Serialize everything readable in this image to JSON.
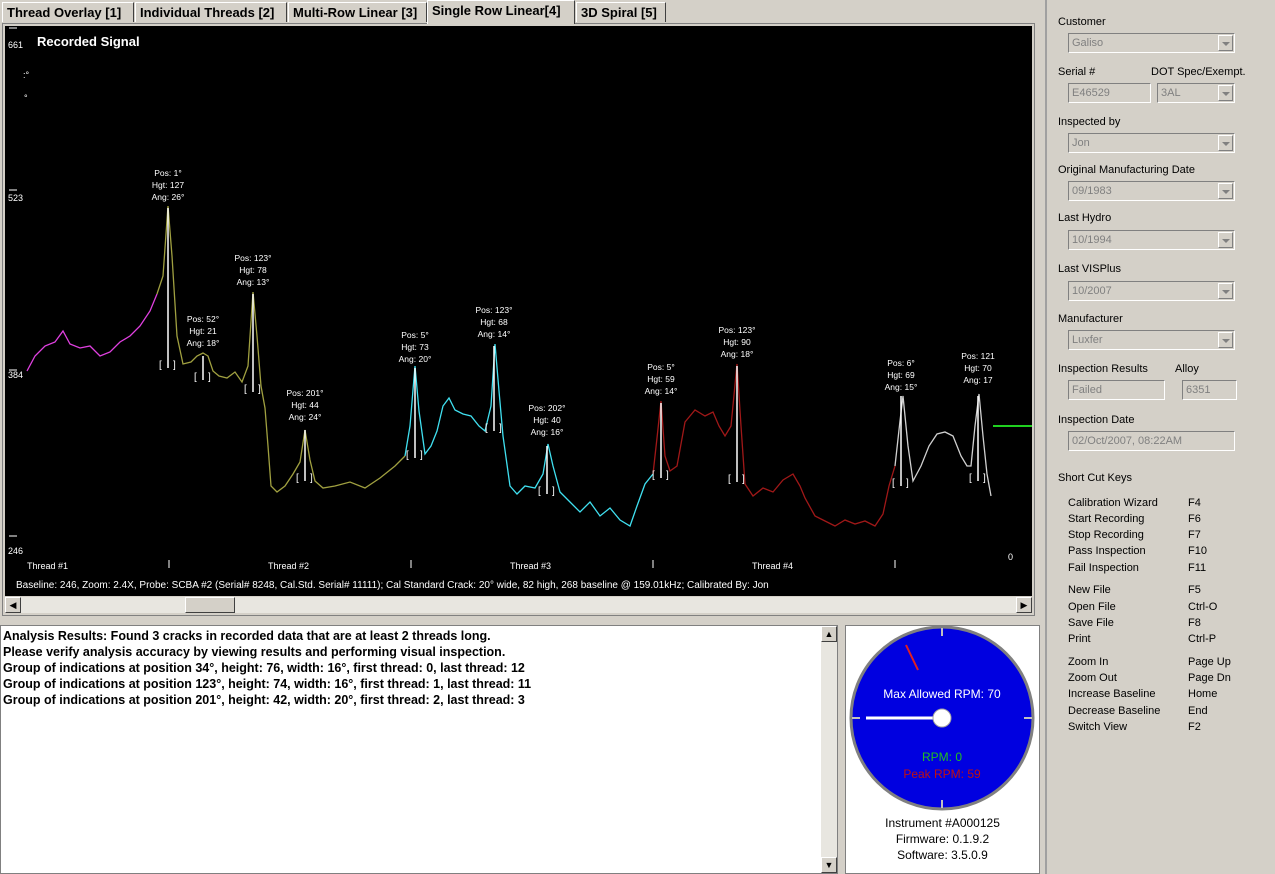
{
  "tabs": [
    {
      "label": "Thread Overlay [1]",
      "active": false
    },
    {
      "label": "Individual Threads [2]",
      "active": false
    },
    {
      "label": "Multi-Row Linear [3]",
      "active": false
    },
    {
      "label": "Single Row Linear[4]",
      "active": true
    },
    {
      "label": "3D Spiral [5]",
      "active": false
    }
  ],
  "plot": {
    "title": "Recorded Signal",
    "y_ticks": [
      "661",
      "523",
      "384",
      "246"
    ],
    "corner_label": "0",
    "thread_labels": [
      "Thread #1",
      "Thread #2",
      "Thread #3",
      "Thread #4"
    ],
    "footer": "Baseline: 246, Zoom: 2.4X, Probe: SCBA #2 (Serial# 8248, Cal.Std. Serial# 11111); Cal Standard Crack: 20° wide, 82 high, 268 baseline @ 159.01kHz; Calibrated By: Jon",
    "peak_labels": [
      {
        "pos": "Pos: 1°",
        "hgt": "Hgt: 127",
        "ang": "Ang: 26°"
      },
      {
        "pos": "Pos: 52°",
        "hgt": "Hgt: 21",
        "ang": "Ang: 18°"
      },
      {
        "pos": "Pos: 123°",
        "hgt": "Hgt: 78",
        "ang": "Ang: 13°"
      },
      {
        "pos": "Pos: 201°",
        "hgt": "Hgt: 44",
        "ang": "Ang: 24°"
      },
      {
        "pos": "Pos: 5°",
        "hgt": "Hgt: 73",
        "ang": "Ang: 20°"
      },
      {
        "pos": "Pos: 123°",
        "hgt": "Hgt: 68",
        "ang": "Ang: 14°"
      },
      {
        "pos": "Pos: 202°",
        "hgt": "Hgt: 40",
        "ang": "Ang: 16°"
      },
      {
        "pos": "Pos: 5°",
        "hgt": "Hgt: 59",
        "ang": "Ang: 14°"
      },
      {
        "pos": "Pos: 123°",
        "hgt": "Hgt: 90",
        "ang": "Ang: 18°"
      },
      {
        "pos": "Pos: 6°",
        "hgt": "Hgt: 69",
        "ang": "Ang: 15°"
      },
      {
        "pos": "Pos: 121",
        "hgt": "Hgt: 70",
        "ang": "Ang: 17"
      }
    ],
    "colors": {
      "thread1": "#e040e0",
      "thread2": "#a0a040",
      "thread3": "#40e0f0",
      "thread4": "#a01818",
      "thread5": "#d0d0d0",
      "marker": "#20d020"
    }
  },
  "results": {
    "lines": [
      "Analysis Results: Found 3 cracks in recorded data that are at least 2 threads long.",
      "Please verify analysis accuracy by viewing results and performing visual inspection.",
      "Group of indications at position 34°, height: 76, width: 16°, first thread: 0, last thread: 12",
      "Group of indications at position 123°, height: 74, width: 16°, first thread: 1, last thread: 11",
      "Group of indications at position 201°, height: 42, width: 20°, first thread: 2, last thread: 3"
    ]
  },
  "gauge": {
    "max_label": "Max Allowed RPM: 70",
    "rpm_label": "RPM: 0",
    "peak_label": "Peak RPM: 59",
    "instrument": "Instrument #A000125",
    "firmware": "Firmware: 0.1.9.2",
    "software": "Software: 3.5.0.9",
    "colors": {
      "dial": "#0000e0",
      "rpm": "#20c020",
      "peak": "#c01010"
    }
  },
  "form": {
    "customer_label": "Customer",
    "customer": "Galiso",
    "serial_label": "Serial #",
    "serial": "E46529",
    "dot_label": "DOT Spec/Exempt.",
    "dot": "3AL",
    "inspected_by_label": "Inspected by",
    "inspected_by": "Jon",
    "orig_date_label": "Original Manufacturing Date",
    "orig_date": "09/1983",
    "last_hydro_label": "Last Hydro",
    "last_hydro": "10/1994",
    "last_visplus_label": "Last VISPlus",
    "last_visplus": "10/2007",
    "manufacturer_label": "Manufacturer",
    "manufacturer": "Luxfer",
    "results_label": "Inspection Results",
    "results": "Failed",
    "alloy_label": "Alloy",
    "alloy": "6351",
    "date_label": "Inspection Date",
    "date": "02/Oct/2007, 08:22AM"
  },
  "shortcuts": {
    "title": "Short Cut Keys",
    "items": [
      {
        "name": "Calibration Wizard",
        "key": "F4"
      },
      {
        "name": "Start Recording",
        "key": "F6"
      },
      {
        "name": "Stop Recording",
        "key": "F7"
      },
      {
        "name": "Pass Inspection",
        "key": "F10"
      },
      {
        "name": "Fail Inspection",
        "key": "F11"
      },
      {
        "name": "New File",
        "key": "F5"
      },
      {
        "name": "Open File",
        "key": "Ctrl-O"
      },
      {
        "name": "Save File",
        "key": "F8"
      },
      {
        "name": "Print",
        "key": "Ctrl-P"
      },
      {
        "name": "Zoom In",
        "key": "Page Up"
      },
      {
        "name": "Zoom Out",
        "key": "Page Dn"
      },
      {
        "name": "Increase Baseline",
        "key": "Home"
      },
      {
        "name": "Decrease Baseline",
        "key": "End"
      },
      {
        "name": "Switch View",
        "key": "F2"
      }
    ]
  }
}
